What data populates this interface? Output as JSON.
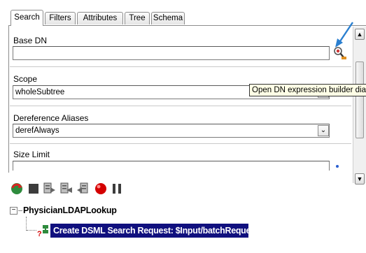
{
  "tabs": [
    "Search",
    "Filters",
    "Attributes",
    "Tree",
    "Schema"
  ],
  "form": {
    "base_dn": {
      "label": "Base DN",
      "value": ""
    },
    "scope": {
      "label": "Scope",
      "value": "wholeSubtree"
    },
    "deref": {
      "label": "Dereference Aliases",
      "value": "derefAlways"
    },
    "size_limit": {
      "label": "Size Limit",
      "value": ""
    }
  },
  "tooltip": "Open DN expression builder dialog",
  "tree": {
    "root": "PhysicianLDAPLookup",
    "toggle": "−",
    "child": "Create DSML Search Request: $Input/batchRequest"
  },
  "toolbar_icons": [
    "refresh-icon",
    "stop-square-icon",
    "step-over-icon",
    "step-into-icon",
    "step-out-icon",
    "breakpoint-icon",
    "pause-icon"
  ],
  "colors": {
    "selection": "#10107e",
    "annotation_arrow": "#2a7fd0",
    "breakpoint": "#d40000"
  }
}
